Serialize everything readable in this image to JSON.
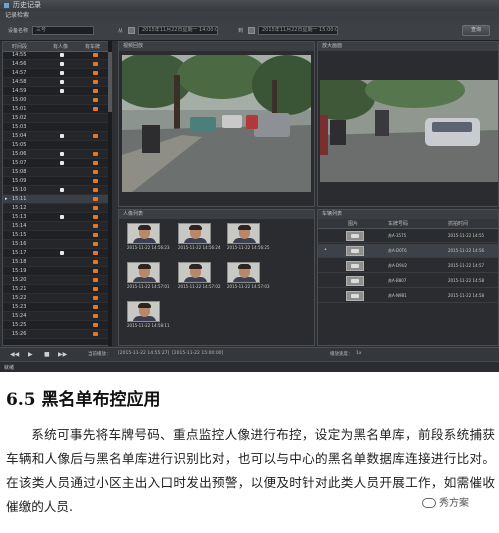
{
  "app": {
    "window_title": "历史记录",
    "menu": "记录检索",
    "toolbar": {
      "device_label": "设备名称",
      "device_value": "三号",
      "start_label": "从",
      "start_value": "2015年11月22日星期一 14:00:00",
      "end_label": "到",
      "end_value": "2015年11月22日星期一 15:00:00",
      "search_button": "查询"
    },
    "timelist": {
      "columns": [
        "时间段",
        "有人像",
        "有车牌"
      ],
      "rows": [
        {
          "time": "14:55",
          "person": true,
          "car": true
        },
        {
          "time": "14:56",
          "person": true,
          "car": true
        },
        {
          "time": "14:57",
          "person": true,
          "car": true
        },
        {
          "time": "14:58",
          "person": true,
          "car": true
        },
        {
          "time": "14:59",
          "person": true,
          "car": true
        },
        {
          "time": "15:00",
          "person": false,
          "car": true
        },
        {
          "time": "15:01",
          "person": false,
          "car": true
        },
        {
          "time": "15:02",
          "person": false,
          "car": false
        },
        {
          "time": "15:03",
          "person": false,
          "car": false
        },
        {
          "time": "15:04",
          "person": true,
          "car": true
        },
        {
          "time": "15:05",
          "person": false,
          "car": false
        },
        {
          "time": "15:06",
          "person": true,
          "car": true
        },
        {
          "time": "15:07",
          "person": true,
          "car": true
        },
        {
          "time": "15:08",
          "person": false,
          "car": true
        },
        {
          "time": "15:09",
          "person": false,
          "car": true
        },
        {
          "time": "15:10",
          "person": true,
          "car": true
        },
        {
          "time": "15:11",
          "person": false,
          "car": true
        },
        {
          "time": "15:12",
          "person": false,
          "car": true
        },
        {
          "time": "15:13",
          "person": true,
          "car": true
        },
        {
          "time": "15:14",
          "person": false,
          "car": true
        },
        {
          "time": "15:15",
          "person": false,
          "car": true
        },
        {
          "time": "15:16",
          "person": false,
          "car": true
        },
        {
          "time": "15:17",
          "person": true,
          "car": true
        },
        {
          "time": "15:18",
          "person": false,
          "car": true
        },
        {
          "time": "15:19",
          "person": false,
          "car": true
        },
        {
          "time": "15:20",
          "person": false,
          "car": true
        },
        {
          "time": "15:21",
          "person": false,
          "car": true
        },
        {
          "time": "15:22",
          "person": false,
          "car": true
        },
        {
          "time": "15:23",
          "person": false,
          "car": true
        },
        {
          "time": "15:24",
          "person": false,
          "car": true
        },
        {
          "time": "15:25",
          "person": false,
          "car": true
        },
        {
          "time": "15:26",
          "person": false,
          "car": true
        }
      ]
    },
    "video_panel": {
      "title": "视频回放"
    },
    "zoom_panel": {
      "title": "放大画面"
    },
    "faces_panel": {
      "title": "人像列表",
      "faces": [
        {
          "caption": "2015-11-22 14:56:23"
        },
        {
          "caption": "2015-11-22 14:56:24"
        },
        {
          "caption": "2015-11-22 14:56:25"
        },
        {
          "caption": "2015-11-22 14:57:01"
        },
        {
          "caption": "2015-11-22 14:57:02"
        },
        {
          "caption": "2015-11-22 14:57:03"
        },
        {
          "caption": "2015-11-22 14:58:11"
        }
      ]
    },
    "alarm_panel": {
      "title": "车辆列表",
      "columns": [
        "图片",
        "车牌号码",
        "抓拍时间"
      ],
      "rows": [
        {
          "plate": "苏A·3575",
          "time": "2015-11-22 14:55"
        },
        {
          "plate": "苏A·D0T6",
          "time": "2015-11-22 14:56"
        },
        {
          "plate": "苏A·D9U2",
          "time": "2015-11-22 14:57"
        },
        {
          "plate": "苏A·B807",
          "time": "2015-11-22 14:58"
        },
        {
          "plate": "苏A·N9B1",
          "time": "2015-11-22 14:58"
        }
      ]
    },
    "controls": {
      "buttons": [
        "◀◀",
        "▶",
        "■",
        "▶▶"
      ],
      "position_label": "当前播放：",
      "position_value": "[2015-11-22 14:55:27]",
      "range_value": "[2015-11-22 15:00:00]",
      "speed_label": "播放速度：",
      "speed_value": "1x"
    },
    "status": "就绪"
  },
  "doc": {
    "heading": "6.5  黑名单布控应用",
    "paragraphs": [
      "系统可事先将车牌号码、重点监控人像进行布控，设定为黑名单库，前段系统捕获车辆和人像后与黑名单库进行识别比对，也可以与中心的黑名单数据库连接进行比对。在该类人员通过小区主出入口时发出预警，以便及时针对此类人员开展工作，如需催收催缴的人员."
    ],
    "watermark": "秀方案"
  }
}
